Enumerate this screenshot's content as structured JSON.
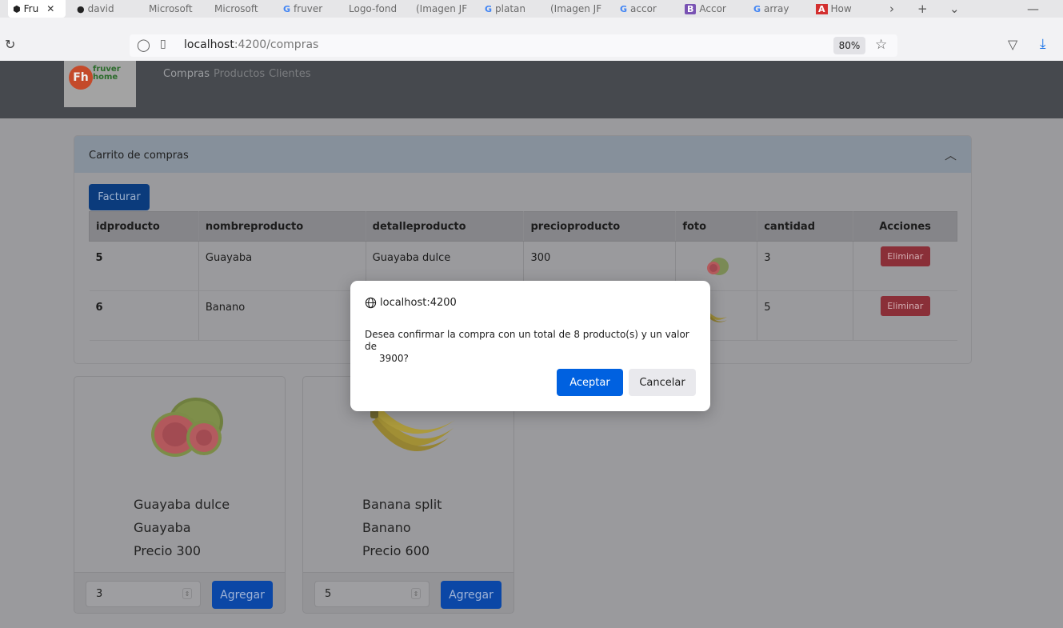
{
  "browser": {
    "tabs": [
      {
        "label": "Fru",
        "icon": "angular-icon",
        "active": true
      },
      {
        "label": "david",
        "icon": "github-icon"
      },
      {
        "label": "Microsoft",
        "icon": "microsoft-icon"
      },
      {
        "label": "Microsoft",
        "icon": "microsoft-icon"
      },
      {
        "label": "fruver",
        "icon": "google-icon"
      },
      {
        "label": "Logo-fond",
        "icon": "page-icon"
      },
      {
        "label": "(Imagen JF",
        "icon": "page-icon"
      },
      {
        "label": "platan",
        "icon": "google-icon"
      },
      {
        "label": "(Imagen JF",
        "icon": "page-icon"
      },
      {
        "label": "accor",
        "icon": "google-icon"
      },
      {
        "label": "Accor",
        "icon": "bootstrap-icon"
      },
      {
        "label": "array",
        "icon": "google-icon"
      },
      {
        "label": "How",
        "icon": "page-icon"
      }
    ],
    "url_host": "localhost",
    "url_path": ":4200/compras",
    "zoom": "80%"
  },
  "nav": {
    "logo_text": "fruver home",
    "links": [
      "Compras",
      "Productos",
      "Clientes"
    ]
  },
  "cart": {
    "title": "Carrito de compras",
    "facturar_label": "Facturar",
    "columns": [
      "idproducto",
      "nombreproducto",
      "detalleproducto",
      "precioproducto",
      "foto",
      "cantidad",
      "Acciones"
    ],
    "rows": [
      {
        "id": "5",
        "name": "Guayaba",
        "detail": "Guayaba dulce",
        "price": "300",
        "qty": "3",
        "action": "Eliminar"
      },
      {
        "id": "6",
        "name": "Banano",
        "detail": "",
        "price": "",
        "qty": "5",
        "action": "Eliminar"
      }
    ]
  },
  "products": [
    {
      "detail": "Guayaba dulce",
      "name": "Guayaba",
      "price": "Precio 300",
      "qty": "3",
      "add_label": "Agregar"
    },
    {
      "detail": "Banana split",
      "name": "Banano",
      "price": "Precio 600",
      "qty": "5",
      "add_label": "Agregar"
    }
  ],
  "dialog": {
    "origin": "localhost:4200",
    "message": "Desea confirmar la compra con un total de 8 producto(s) y un valor de",
    "value": "3900?",
    "ok_label": "Aceptar",
    "cancel_label": "Cancelar"
  }
}
